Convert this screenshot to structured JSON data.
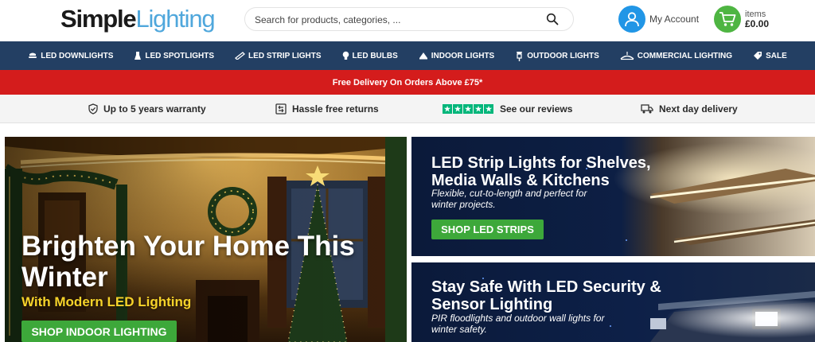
{
  "header": {
    "logo_part1": "Simple",
    "logo_part2": "Lighting",
    "search_placeholder": "Search for products, categories, ...",
    "account_label": "My Account",
    "cart_items_label": "items",
    "cart_total": "£0.00"
  },
  "nav": {
    "items": [
      {
        "label": "LED DOWNLIGHTS",
        "icon": "downlight-icon"
      },
      {
        "label": "LED SPOTLIGHTS",
        "icon": "spotlight-icon"
      },
      {
        "label": "LED STRIP LIGHTS",
        "icon": "strip-light-icon"
      },
      {
        "label": "LED BULBS",
        "icon": "bulb-icon"
      },
      {
        "label": "INDOOR LIGHTS",
        "icon": "indoor-light-icon"
      },
      {
        "label": "OUTDOOR LIGHTS",
        "icon": "outdoor-light-icon"
      },
      {
        "label": "COMMERCIAL LIGHTING",
        "icon": "commercial-light-icon"
      },
      {
        "label": "SALE",
        "icon": "sale-tag-icon"
      }
    ]
  },
  "promo": {
    "text": "Free Delivery On Orders Above £75*"
  },
  "usp": {
    "warranty": "Up to 5 years warranty",
    "returns": "Hassle free returns",
    "reviews": "See our reviews",
    "delivery": "Next day delivery"
  },
  "hero": {
    "title": "Brighten Your Home This Winter",
    "subtitle": "With Modern LED Lighting",
    "button": "SHOP INDOOR LIGHTING"
  },
  "banner_strips": {
    "title": "LED Strip Lights for  Shelves, Media Walls & Kitchens",
    "subtitle": "Flexible, cut-to-length and perfect for winter projects.",
    "button": "SHOP LED STRIPS"
  },
  "banner_security": {
    "title": "Stay Safe With LED Security & Sensor Lighting",
    "subtitle": "PIR floodlights and outdoor wall lights for winter safety."
  },
  "colors": {
    "nav_bg": "#233f63",
    "promo_red": "#d41c1c",
    "cta_green": "#3da83a",
    "logo_blue": "#4fa7dc",
    "account_blue": "#2196e6",
    "trustpilot_green": "#00b67a",
    "hero_subtitle_yellow": "#f6d32a"
  }
}
